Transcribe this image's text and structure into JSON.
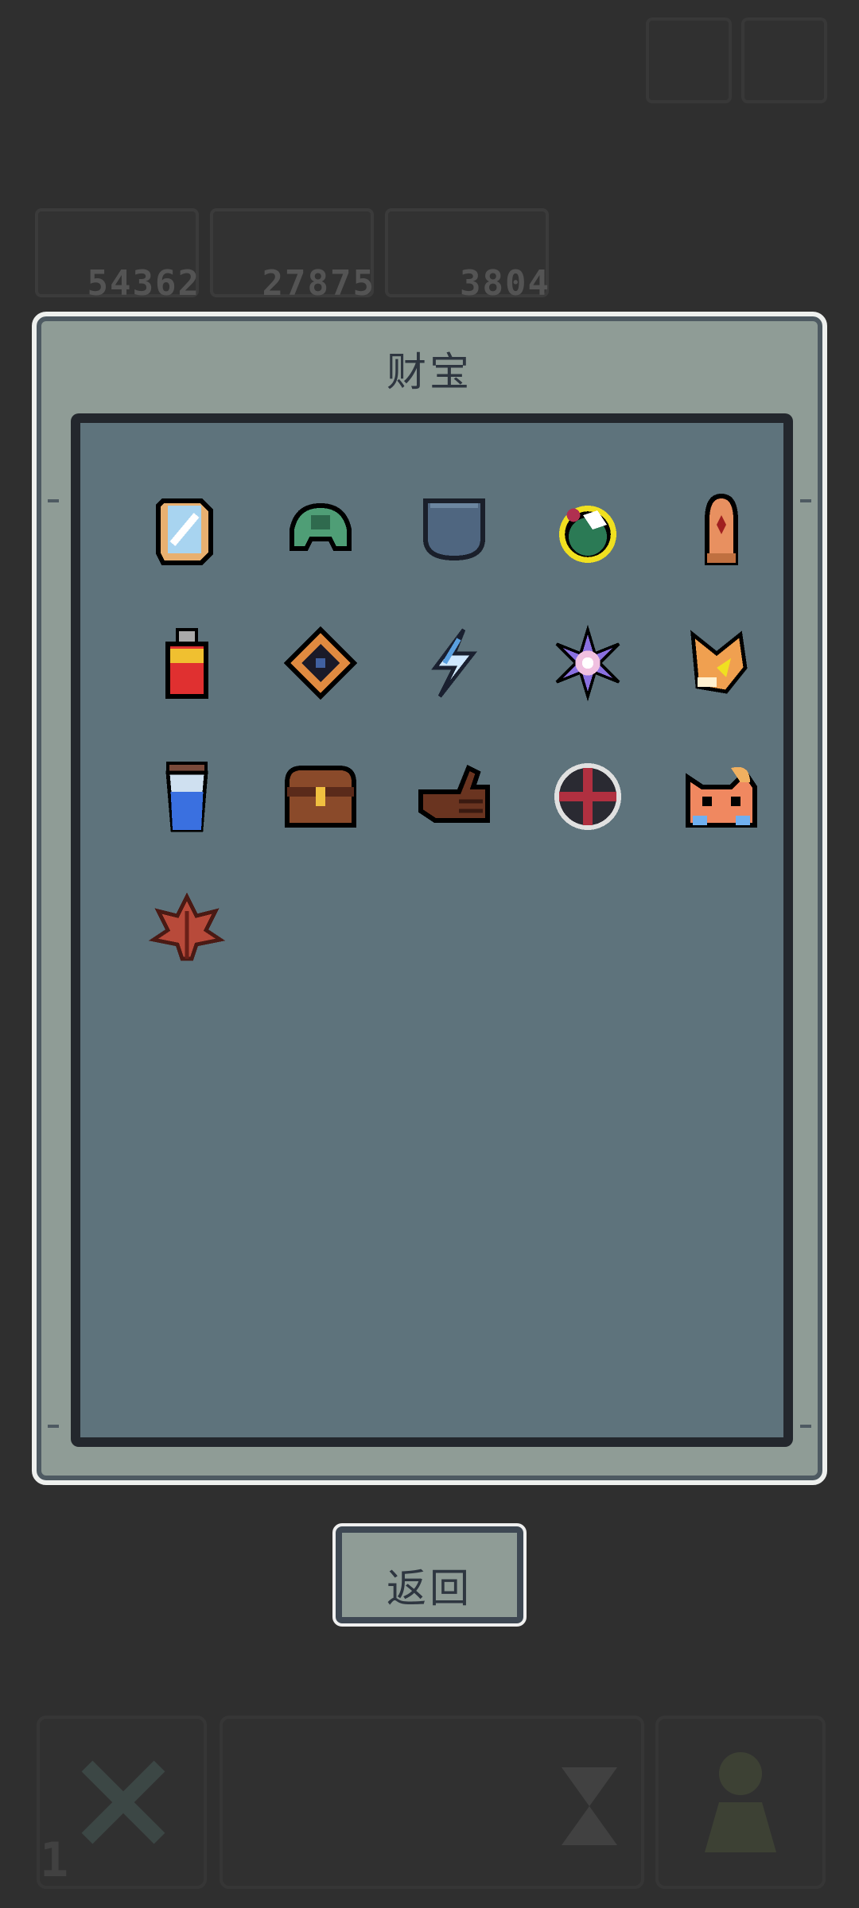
{
  "hud": {
    "resources": [
      {
        "value": "54362",
        "icon": "mask-icon"
      },
      {
        "value": "27875",
        "icon": "gate-icon"
      },
      {
        "value": "3804",
        "icon": "skull-icon"
      }
    ],
    "bottom_counter": "1"
  },
  "panel": {
    "title": "财宝",
    "items": [
      {
        "icon": "mirror-icon"
      },
      {
        "icon": "turtle-shell-icon"
      },
      {
        "icon": "pocket-icon"
      },
      {
        "icon": "green-potion-orb-icon",
        "selected": true
      },
      {
        "icon": "bullet-icon"
      },
      {
        "icon": "usb-drive-icon"
      },
      {
        "icon": "diamond-gem-icon"
      },
      {
        "icon": "lightning-icon"
      },
      {
        "icon": "purple-star-icon"
      },
      {
        "icon": "fox-tail-icon"
      },
      {
        "icon": "water-cup-icon"
      },
      {
        "icon": "treasure-chest-icon"
      },
      {
        "icon": "leather-glove-icon"
      },
      {
        "icon": "crosshair-icon"
      },
      {
        "icon": "cat-face-icon"
      },
      {
        "icon": "maple-leaf-icon"
      }
    ]
  },
  "back_button": {
    "label": "返回"
  },
  "colors": {
    "background": "#2f2f2f",
    "panel": "#8f9c96",
    "inner": "#5e737c",
    "selected": "#f0e020"
  }
}
